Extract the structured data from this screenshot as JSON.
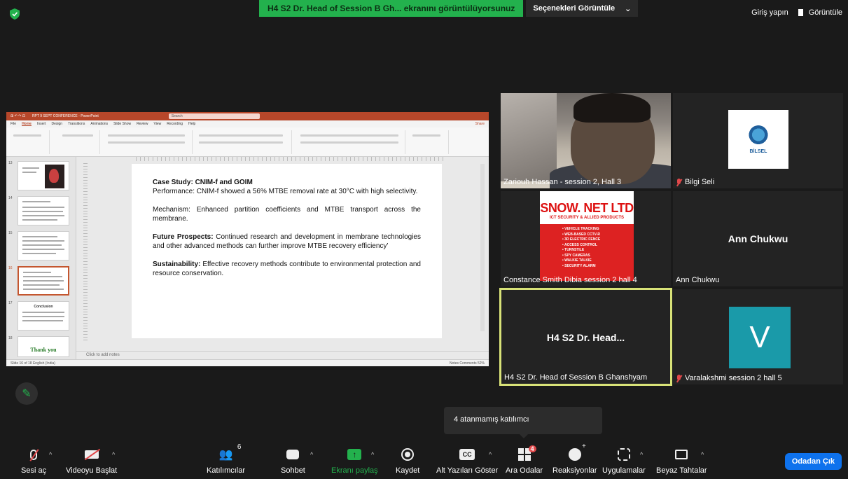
{
  "top_bar": {
    "share_banner": "H4 S2 Dr. Head of Session B Gh... ekranını görüntülüyorsunuz",
    "view_options": "Seçenekleri Görüntüle",
    "view_options_caret": "⌄",
    "sign_in": "Giriş yapın",
    "view": "Görüntüle"
  },
  "ppt": {
    "title": "RPT 9 SEPT CONFERENCE - PowerPoint",
    "search": "Search",
    "menu": [
      "File",
      "Home",
      "Insert",
      "Design",
      "Transitions",
      "Animations",
      "Slide Show",
      "Review",
      "View",
      "Recording",
      "Help"
    ],
    "share": "Share",
    "thumb_numbers": [
      "13",
      "14",
      "15",
      "16",
      "17",
      "18"
    ],
    "thumb_17_title": "Conclusion",
    "thumb_18_title": "Thank you",
    "slide": {
      "p1_title": "Case Study: CNIM-f and GOIM",
      "p1_text": "Performance: CNIM-f showed a 56% MTBE removal rate at 30°C with high selectivity.",
      "p2_text": "Mechanism: Enhanced partition coefficients and MTBE transport across the membrane.",
      "p3_title": "Future Prospects:",
      "p3_text": " Continued research and development in membrane technologies and other advanced methods can further improve MTBE recovery efficiency’",
      "p4_title": "Sustainability:",
      "p4_text": " Effective recovery methods contribute to environmental protection and resource conservation."
    },
    "notes_placeholder": "Click to add notes",
    "status_left": "Slide 16 of 18    English (India)",
    "status_right": "Notes   Comments          52%"
  },
  "participants": [
    {
      "name": "Zariouh Hassan  - session 2, Hall 3",
      "muted": false
    },
    {
      "name": "Bilgi Seli",
      "muted": true,
      "logo_text": "BİLSEL"
    },
    {
      "name": "Constance Smith Dibia session 2 hall 4",
      "muted": false
    },
    {
      "name": "Ann Chukwu",
      "muted": false,
      "display": "Ann Chukwu"
    },
    {
      "name": "H4 S2 Dr. Head of Session B Ghanshyam",
      "muted": false,
      "display": "H4 S2 Dr. Head..."
    },
    {
      "name": "Varalakshmi session 2 hall 5",
      "muted": true,
      "avatar_letter": "V"
    }
  ],
  "snow_net": {
    "title": "SNOW. NET LTD",
    "subtitle": "ICT SECURITY & ALLIED PRODUCTS",
    "items": [
      "VEHICLE TRACKING",
      "WEB-BASED CCTV-R",
      "3D ELECTRIC FENCE",
      "ACCESS CONTROL",
      "TURNSTILE",
      "SPY CAMERAS",
      "WALKIE TALKIE",
      "SECURITY ALARM"
    ]
  },
  "tooltip": "4 atanmamış katılımcı",
  "toolbar": {
    "mute": "Sesi aç",
    "video": "Videoyu Başlat",
    "participants": "Katılımcılar",
    "participants_count": "6",
    "chat": "Sohbet",
    "share": "Ekranı paylaş",
    "record": "Kaydet",
    "captions": "Alt Yazıları Göster",
    "captions_icon": "CC",
    "breakout": "Ara Odalar",
    "breakout_badge": "4",
    "reactions": "Reaksiyonlar",
    "apps": "Uygulamalar",
    "whiteboard": "Beyaz Tahtalar",
    "leave": "Odadan Çık"
  },
  "colors": {
    "accent_green": "#23b14d",
    "leave_blue": "#0e72ed",
    "active_speaker": "#d8e278",
    "ppt_red": "#b7472a"
  }
}
